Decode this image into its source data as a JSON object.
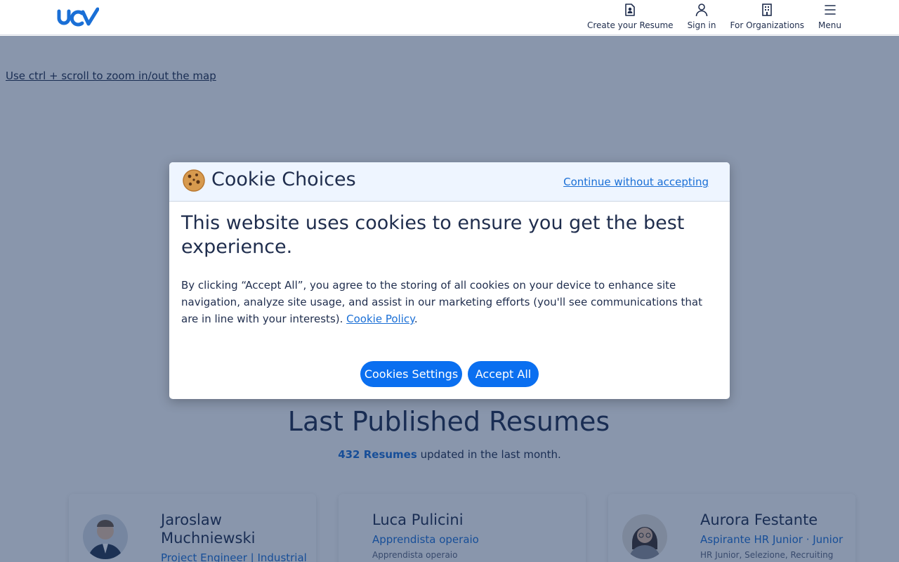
{
  "header": {
    "nav": [
      {
        "label": "Create your Resume",
        "icon": "resume-file-icon"
      },
      {
        "label": "Sign in",
        "icon": "user-icon"
      },
      {
        "label": "For Organizations",
        "icon": "building-icon"
      },
      {
        "label": "Menu",
        "icon": "hamburger-menu-icon"
      }
    ]
  },
  "map": {
    "hint": "Use ctrl + scroll to zoom in/out the map"
  },
  "resumes": {
    "title": "Last Published Resumes",
    "count": "432 Resumes",
    "count_suffix": " updated in the last month.",
    "cards": [
      {
        "name_line1": "Jaroslaw",
        "name_line2": "Muchniewski",
        "role": "Project Engineer | Industrial",
        "description": ""
      },
      {
        "name_line1": "Luca Pulicini",
        "name_line2": "",
        "role": "Apprendista operaio",
        "description": "Apprendista operaio"
      },
      {
        "name_line1": "Aurora Festante",
        "name_line2": "",
        "role": "Aspirante HR Junior · Junior",
        "description": "HR Junior, Selezione, Recruiting"
      }
    ]
  },
  "cookie_modal": {
    "title": "Cookie Choices",
    "continue_link": "Continue without accepting",
    "headline": "This website uses cookies to ensure you get the best experience.",
    "text": "By clicking “Accept All”, you agree to the storing of all cookies on your device to enhance site navigation, analyze site usage, and assist in our marketing efforts (you'll see communications that are in line with your interests). ",
    "policy_link": "Cookie Policy",
    "text_end": ".",
    "settings_button": "Cookies Settings",
    "accept_button": "Accept All"
  },
  "colors": {
    "brand": "#1a6fd6",
    "button": "#0a6ff0",
    "text": "#1f2d4d"
  }
}
